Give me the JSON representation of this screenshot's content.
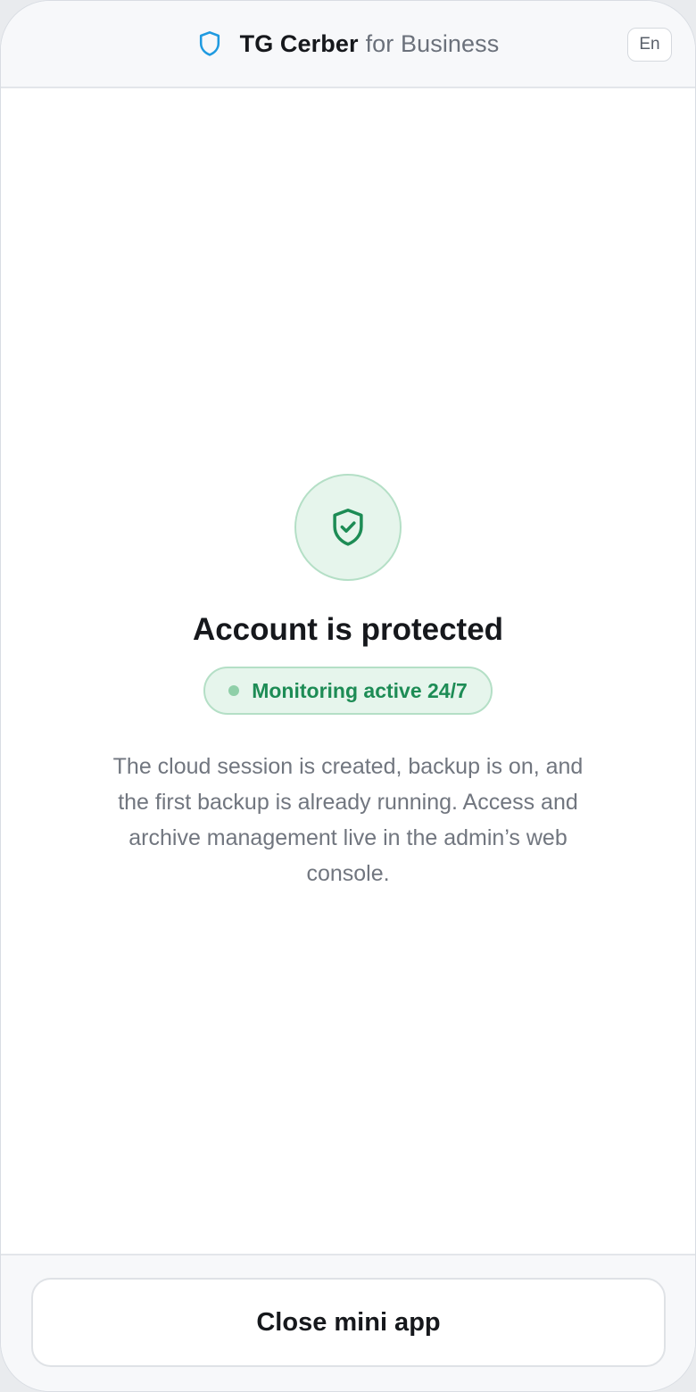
{
  "header": {
    "brand_name": "TG Cerber",
    "brand_suffix": "for Business",
    "language_label": "En",
    "brand_icon": "shield-icon"
  },
  "status": {
    "icon": "shield-check-icon",
    "title": "Account is protected",
    "badge_label": "Monitoring active 24/7",
    "description": "The cloud session is created, backup is on, and the first backup is already running. Access and archive management live in the admin’s web console."
  },
  "footer": {
    "close_label": "Close mini app"
  },
  "colors": {
    "brand_accent": "#1f9ae0",
    "success_green": "#1d8c55",
    "success_bg": "#e6f5ec",
    "success_border": "#b4dfc6"
  }
}
